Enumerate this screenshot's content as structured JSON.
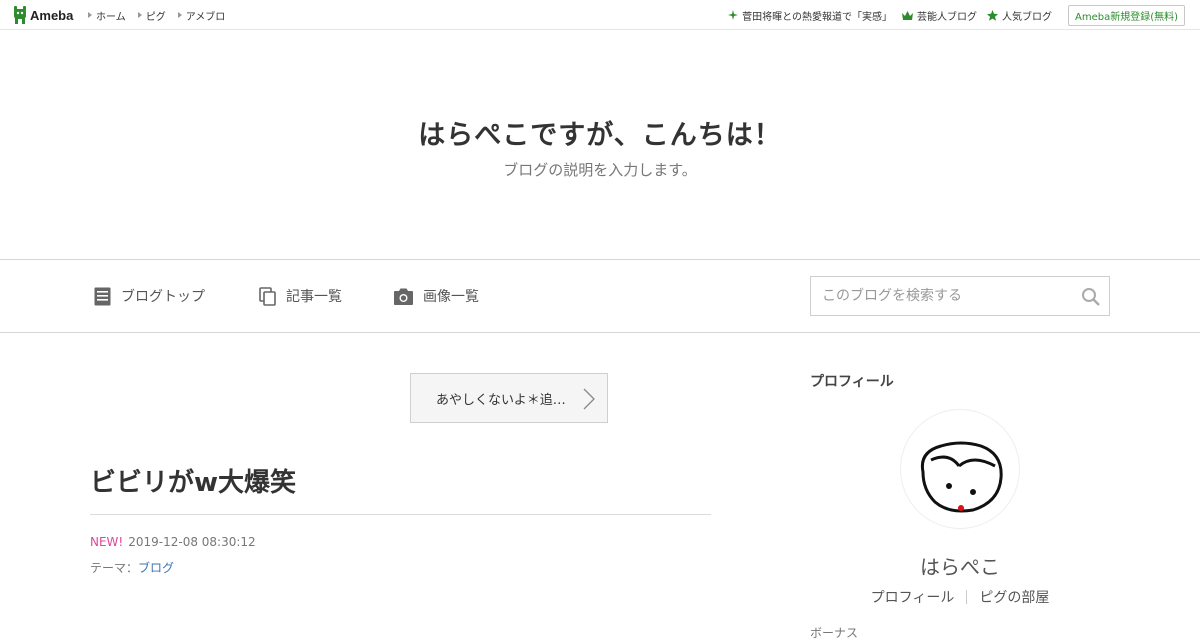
{
  "topbar": {
    "logo_text": "Ameba",
    "nav": [
      "ホーム",
      "ピグ",
      "アメブロ"
    ],
    "right": [
      {
        "label": "菅田将暉との熱愛報道で「実感」",
        "icon": "sparkle-icon"
      },
      {
        "label": "芸能人ブログ",
        "icon": "crown-icon"
      },
      {
        "label": "人気ブログ",
        "icon": "star-icon"
      }
    ],
    "register_label": "Ameba新規登録(無料)"
  },
  "header": {
    "title": "はらぺこですが、こんちは！",
    "description": "ブログの説明を入力します。"
  },
  "nav": {
    "blog_top": "ブログトップ",
    "entry_list": "記事一覧",
    "image_list": "画像一覧",
    "search_placeholder": "このブログを検索する"
  },
  "main": {
    "next_post_label": "あやしくないよ＊追…",
    "entry_title": "ビビリがw大爆笑",
    "new_label": "NEW!",
    "date": "2019-12-08 08:30:12",
    "theme_prefix": "テーマ：",
    "theme_link": "ブログ"
  },
  "sidebar": {
    "heading": "プロフィール",
    "name": "はらぺこ",
    "links": [
      "プロフィール",
      "ピグの部屋"
    ],
    "partial_text": "ボーナス"
  },
  "colors": {
    "accent_green": "#2d8c2d",
    "new_pink": "#e0459b",
    "link_blue": "#3d72b5"
  }
}
